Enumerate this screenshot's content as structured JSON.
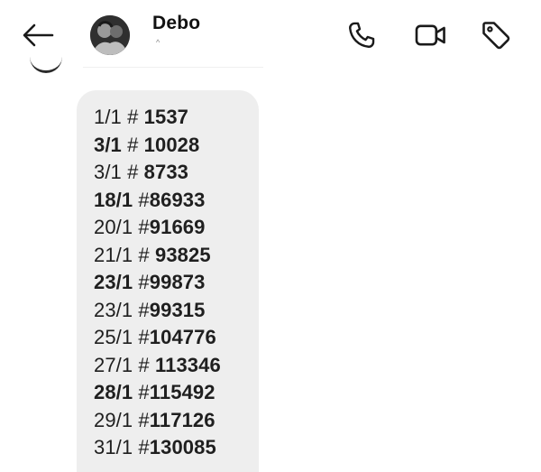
{
  "header": {
    "contact_name": "Debo",
    "contact_sub": "^",
    "icons": {
      "back": "arrow-left-icon",
      "call": "phone-icon",
      "video": "video-camera-icon",
      "tag": "tag-icon"
    }
  },
  "message": {
    "lines": [
      {
        "date": "1/1",
        "sep": " # ",
        "num": "1537",
        "bold_date": false
      },
      {
        "date": "3/1",
        "sep": " # ",
        "num": "10028",
        "bold_date": true
      },
      {
        "date": "3/1",
        "sep": " # ",
        "num": "8733",
        "bold_date": false
      },
      {
        "date": "18/1",
        "sep": " #",
        "num": "86933",
        "bold_date": true
      },
      {
        "date": "20/1",
        "sep": " #",
        "num": "91669",
        "bold_date": false
      },
      {
        "date": "21/1",
        "sep": " # ",
        "num": "93825",
        "bold_date": false
      },
      {
        "date": "23/1",
        "sep": " #",
        "num": "99873",
        "bold_date": true
      },
      {
        "date": "23/1",
        "sep": " #",
        "num": "99315",
        "bold_date": false
      },
      {
        "date": "25/1",
        "sep": " #",
        "num": "104776",
        "bold_date": false
      },
      {
        "date": "27/1",
        "sep": " # ",
        "num": "113346",
        "bold_date": false
      },
      {
        "date": "28/1",
        "sep": " #",
        "num": "115492",
        "bold_date": true
      },
      {
        "date": "29/1",
        "sep": " #",
        "num": "117126",
        "bold_date": false
      },
      {
        "date": "31/1",
        "sep": " #",
        "num": "130085",
        "bold_date": false
      }
    ]
  }
}
